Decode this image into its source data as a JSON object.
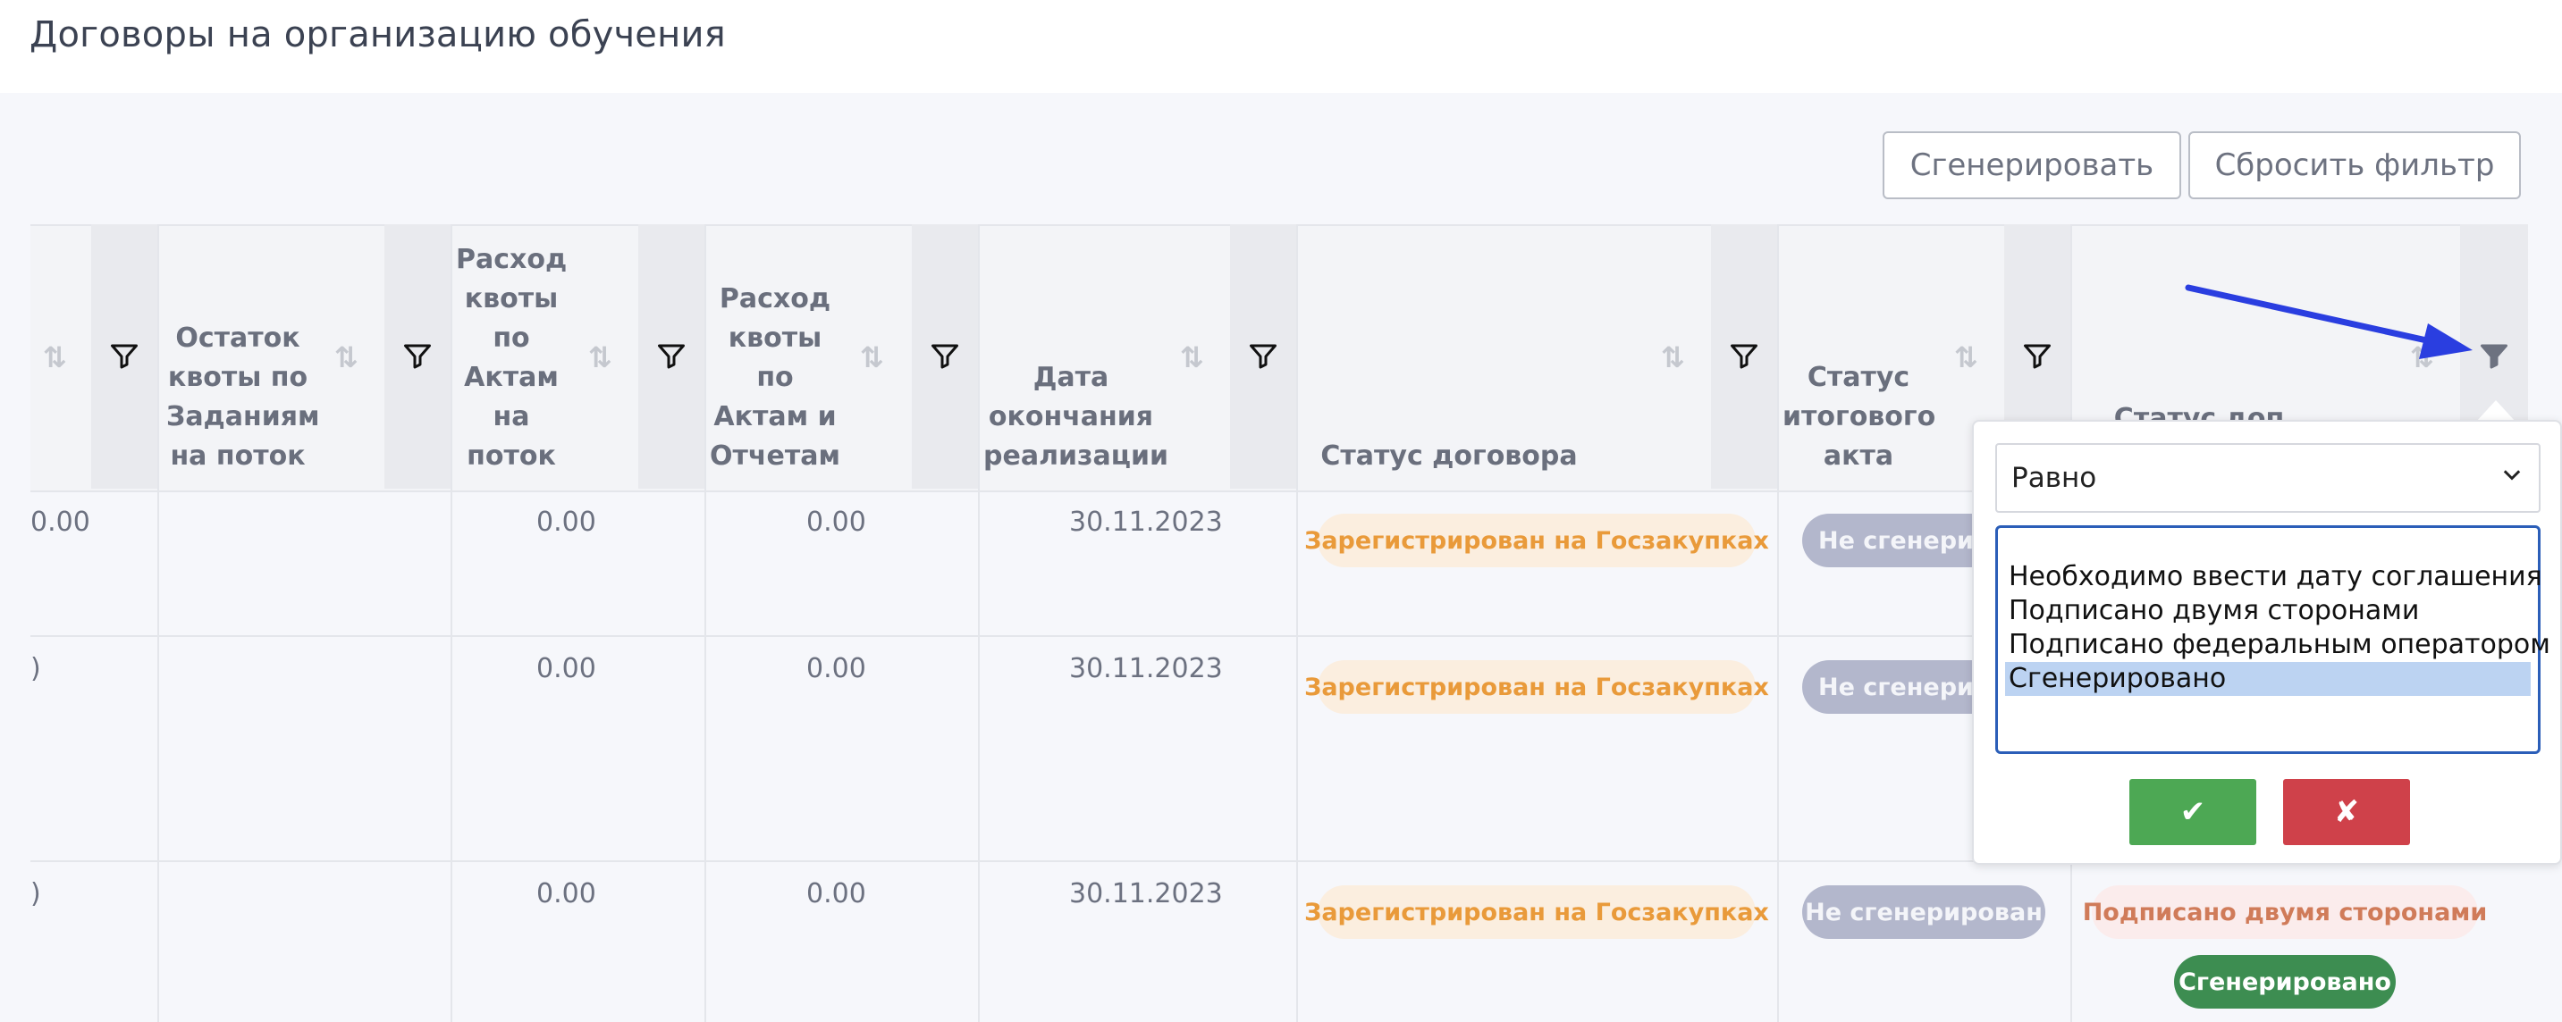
{
  "page": {
    "title": "Договоры на организацию обучения"
  },
  "toolbar": {
    "generate_label": "Сгенерировать",
    "reset_filter_label": "Сбросить фильтр"
  },
  "columns": [
    {
      "label": ""
    },
    {
      "label": "Остаток\nквоты по\nЗаданиям\nна поток"
    },
    {
      "label": "Расход\nквоты\nпо\nАктам\nна\nпоток"
    },
    {
      "label": "Расход\nквоты\nпо\nАктам и\nОтчетам"
    },
    {
      "label": "Дата\nокончания\nреализации"
    },
    {
      "label": "Статус договора"
    },
    {
      "label": "Статус\nитогового\nакта"
    },
    {
      "label": "Статус доп"
    }
  ],
  "rows": [
    {
      "c0": "0.00",
      "c2": "0.00",
      "c3": "0.00",
      "date": "30.11.2023",
      "contract_status": "Зарегистрирован на Госзакупках",
      "act_status": "Не сгенерир"
    },
    {
      "c0": ")",
      "c2": "0.00",
      "c3": "0.00",
      "date": "30.11.2023",
      "contract_status": "Зарегистрирован на Госзакупках",
      "act_status": "Не сгенерир"
    },
    {
      "c0": ")",
      "c2": "0.00",
      "c3": "0.00",
      "date": "30.11.2023",
      "contract_status": "Зарегистрирован на Госзакупках",
      "act_status": "Не сгенерирован",
      "dop_status_1": "Подписано двумя сторонами",
      "dop_status_2": "Сгенерировано"
    }
  ],
  "filter_popup": {
    "operator": "Равно",
    "options": [
      "Необходимо ввести дату соглашения",
      "Подписано двумя сторонами",
      "Подписано федеральным оператором",
      "Сгенерировано"
    ],
    "selected_option": "Сгенерировано",
    "confirm_glyph": "✔",
    "cancel_glyph": "✘"
  },
  "colors": {
    "accent_blue": "#2a3ee0",
    "ok_green": "#4da854",
    "cancel_red": "#cf414a",
    "badge_orange_text": "#e99a3a",
    "badge_green": "#3d8d51"
  }
}
